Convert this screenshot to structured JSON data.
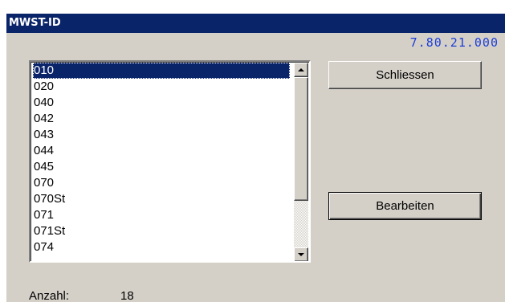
{
  "window": {
    "title": "MWST-ID",
    "version": "7.80.21.000"
  },
  "list": {
    "items": [
      "010",
      "020",
      "040",
      "042",
      "043",
      "044",
      "045",
      "070",
      "070St",
      "071",
      "071St",
      "074"
    ],
    "selected_index": 0
  },
  "buttons": {
    "close_label": "Schliessen",
    "edit_label": "Bearbeiten"
  },
  "footer": {
    "count_label": "Anzahl:",
    "count_value": "18"
  },
  "colors": {
    "titlebar": "#0a246a",
    "version_text": "#1f3fd6",
    "window_bg": "#d4d0c8",
    "selection": "#0a246a"
  }
}
